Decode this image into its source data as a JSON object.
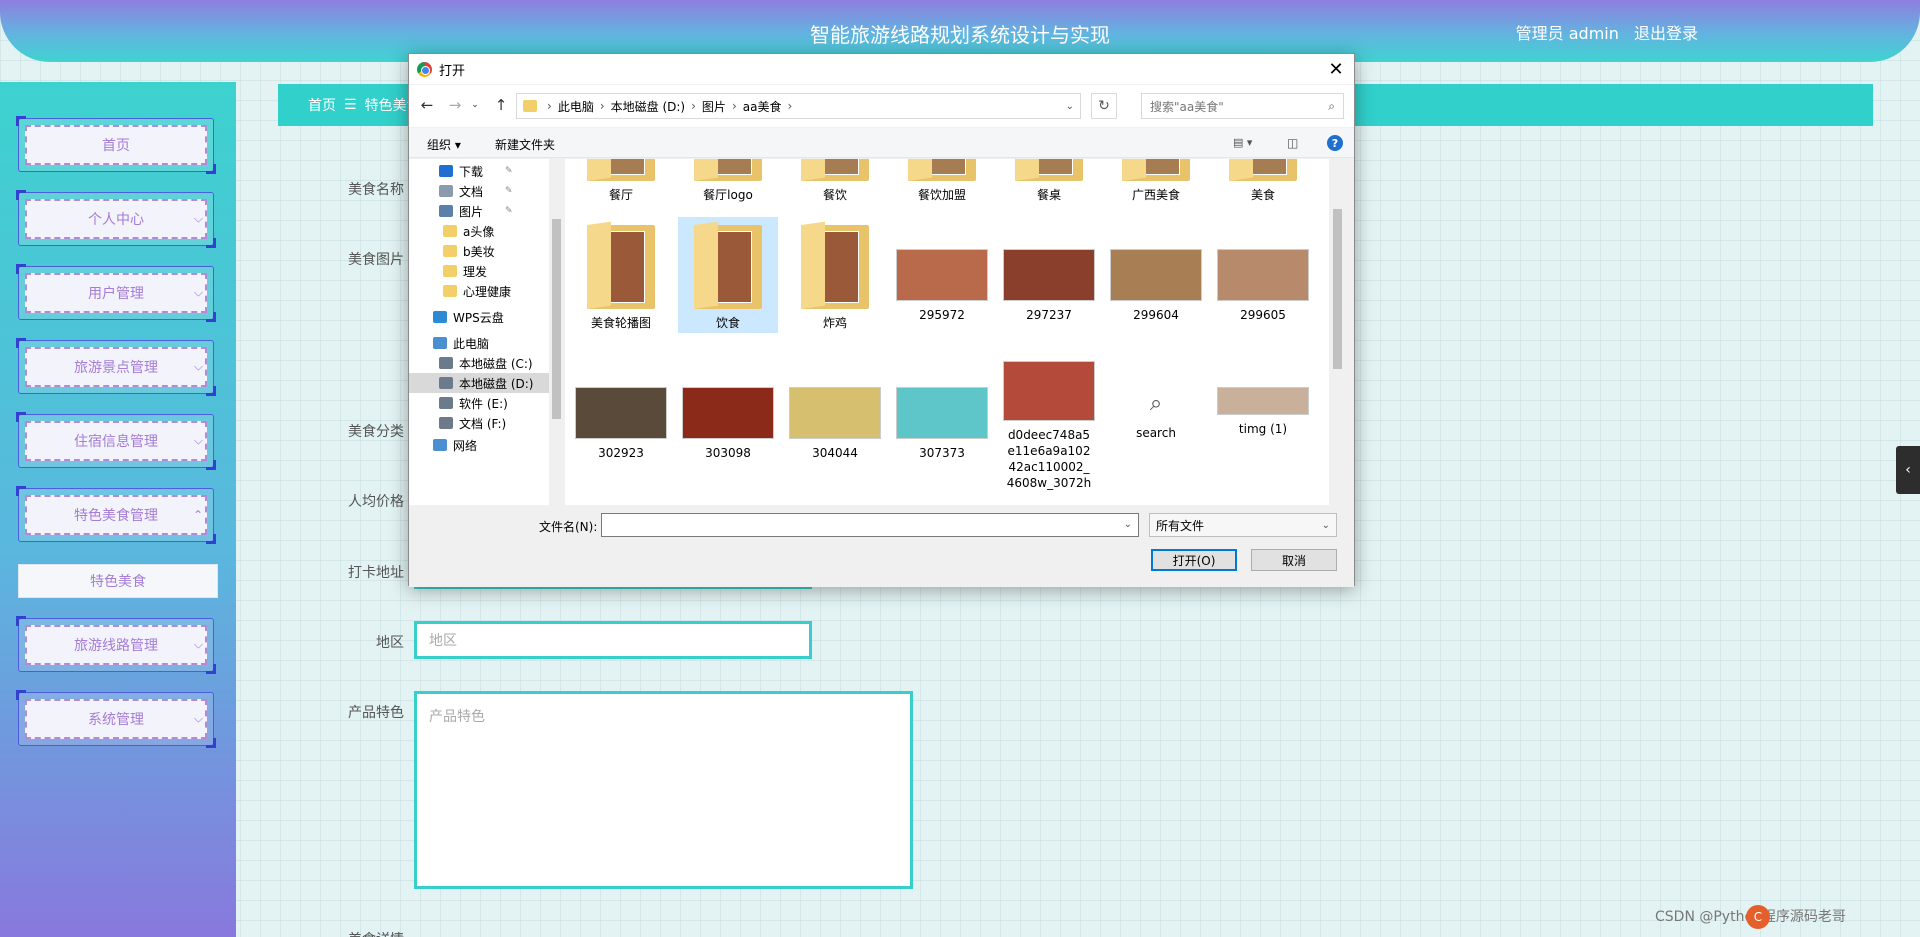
{
  "header": {
    "title": "智能旅游线路规划系统设计与实现",
    "user_label": "管理员 admin",
    "logout": "退出登录"
  },
  "sidebar": {
    "items": [
      {
        "label": "首页",
        "has_chevron": false
      },
      {
        "label": "个人中心",
        "has_chevron": true
      },
      {
        "label": "用户管理",
        "has_chevron": true
      },
      {
        "label": "旅游景点管理",
        "has_chevron": true
      },
      {
        "label": "住宿信息管理",
        "has_chevron": true
      },
      {
        "label": "特色美食管理",
        "has_chevron": true,
        "expanded": true
      },
      {
        "label": "旅游线路管理",
        "has_chevron": true
      },
      {
        "label": "系统管理",
        "has_chevron": true
      }
    ],
    "submenu": {
      "label": "特色美食"
    },
    "chevron_down": "⌵",
    "chevron_up": "⌃"
  },
  "breadcrumb": {
    "home": "首页",
    "sep": "☰",
    "current": "特色美食"
  },
  "form": {
    "name_label": "美食名称",
    "image_label": "美食图片",
    "category_label": "美食分类",
    "price_label": "人均价格",
    "address_label": "打卡地址",
    "region_label": "地区",
    "region_placeholder": "地区",
    "feature_label": "产品特色",
    "feature_placeholder": "产品特色",
    "detail_label": "美食详情"
  },
  "dialog": {
    "title": "打开",
    "address": [
      "此电脑",
      "本地磁盘 (D:)",
      "图片",
      "aa美食"
    ],
    "search_placeholder": "搜索\"aa美食\"",
    "toolbar": {
      "organize": "组织 ▾",
      "new_folder": "新建文件夹"
    },
    "nav_items": [
      {
        "label": "下载",
        "pinned": true,
        "type": "download"
      },
      {
        "label": "文档",
        "pinned": true,
        "type": "doc"
      },
      {
        "label": "图片",
        "pinned": true,
        "type": "pic"
      },
      {
        "label": "a头像",
        "type": "folder"
      },
      {
        "label": "b美妆",
        "type": "folder"
      },
      {
        "label": "理发",
        "type": "folder"
      },
      {
        "label": "心理健康",
        "type": "folder"
      },
      {
        "label": "WPS云盘",
        "type": "cloud"
      },
      {
        "label": "此电脑",
        "type": "pc"
      },
      {
        "label": "本地磁盘 (C:)",
        "type": "drive"
      },
      {
        "label": "本地磁盘 (D:)",
        "type": "drive",
        "selected": true
      },
      {
        "label": "软件 (E:)",
        "type": "drive"
      },
      {
        "label": "文档 (F:)",
        "type": "drive"
      },
      {
        "label": "网络",
        "type": "net"
      }
    ],
    "files_row1": [
      "餐厅",
      "餐厅logo",
      "餐饮",
      "餐饮加盟",
      "餐桌",
      "广西美食",
      "美食"
    ],
    "files_row2": [
      {
        "label": "美食轮播图",
        "kind": "folder"
      },
      {
        "label": "饮食",
        "kind": "folder",
        "selected": true
      },
      {
        "label": "炸鸡",
        "kind": "folder"
      },
      {
        "label": "295972",
        "kind": "image",
        "color": "#b86a4a"
      },
      {
        "label": "297237",
        "kind": "image",
        "color": "#8a3f2c"
      },
      {
        "label": "299604",
        "kind": "image",
        "color": "#a87f55"
      },
      {
        "label": "299605",
        "kind": "image",
        "color": "#b68a6a"
      }
    ],
    "files_row3": [
      {
        "label": "302923",
        "kind": "image",
        "color": "#5a4a3a"
      },
      {
        "label": "303098",
        "kind": "image",
        "color": "#8c2a1a"
      },
      {
        "label": "304044",
        "kind": "image",
        "color": "#d6c070"
      },
      {
        "label": "307373",
        "kind": "image",
        "color": "#5ec6c9"
      },
      {
        "label": "d0deec748a5e11e6a9a10242ac110002_4608w_3072h",
        "kind": "image",
        "color": "#b44a3a"
      },
      {
        "label": "search",
        "kind": "search"
      },
      {
        "label": "timg (1)",
        "kind": "image",
        "color": "#c9b09a"
      }
    ],
    "filename_label": "文件名(N):",
    "filetype": "所有文件",
    "open_btn": "打开(O)",
    "cancel_btn": "取消"
  },
  "watermark": "CSDN @Python程序源码老哥"
}
